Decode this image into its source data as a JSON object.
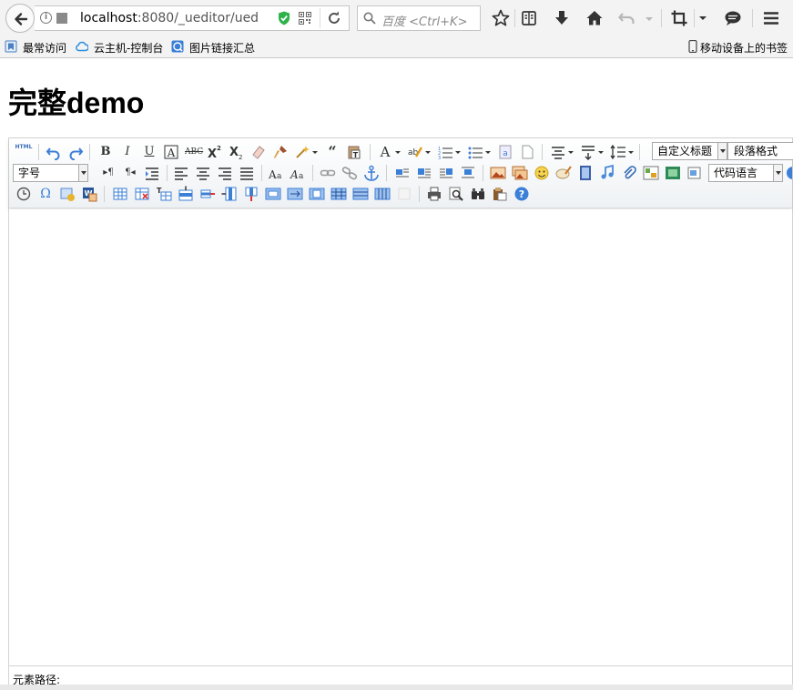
{
  "browser": {
    "url_host": "localhost",
    "url_rest": ":8080/_ueditor/uedi",
    "search_placeholder": "百度 <Ctrl+K>",
    "info_glyph": "i"
  },
  "bookmarks": [
    {
      "label": "最常访问",
      "icon": "bookmark-folder-icon"
    },
    {
      "label": "云主机-控制台",
      "icon": "cloud-icon"
    },
    {
      "label": "图片链接汇总",
      "icon": "globe-icon"
    }
  ],
  "mobile_bookmarks": "移动设备上的书签",
  "page": {
    "title": "完整demo"
  },
  "editor": {
    "html_label": "HTML",
    "custom_heading": "自定义标题",
    "paragraph_format": "段落格式",
    "font_size": "字号",
    "code_language": "代码语言",
    "element_path_label": "元素路径:"
  },
  "colors": {
    "accent_blue": "#3c7fd6",
    "chrome_bg": "#f3f3f3",
    "shield_green": "#2eb34a"
  }
}
